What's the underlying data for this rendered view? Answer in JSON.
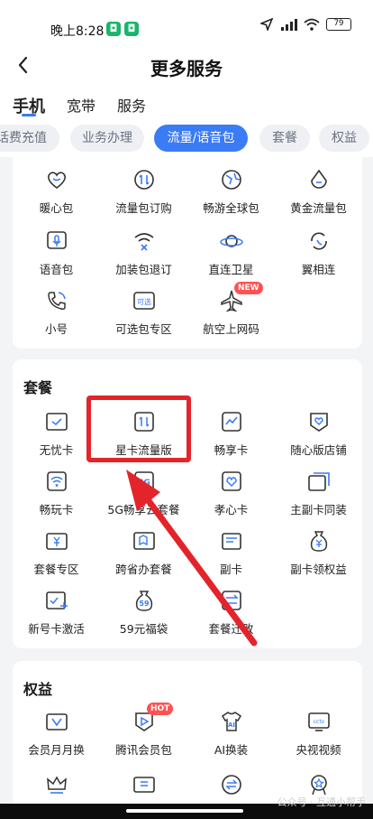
{
  "status_bar": {
    "time": "晚上8:28",
    "app_glyph": "◘",
    "battery": "79"
  },
  "header": {
    "title": "更多服务"
  },
  "top_tabs": [
    {
      "label": "手机"
    },
    {
      "label": "宽带"
    },
    {
      "label": "服务"
    }
  ],
  "pills": [
    {
      "label": "话费充值"
    },
    {
      "label": "业务办理"
    },
    {
      "label": "流量/语音包"
    },
    {
      "label": "套餐"
    },
    {
      "label": "权益"
    }
  ],
  "flow_items": [
    {
      "label": "暖心包",
      "icon": "heart-icon"
    },
    {
      "label": "流量包订购",
      "icon": "data-arrows-icon"
    },
    {
      "label": "畅游全球包",
      "icon": "globe-icon"
    },
    {
      "label": "黄金流量包",
      "icon": "drop-icon"
    },
    {
      "label": "语音包",
      "icon": "mic-icon"
    },
    {
      "label": "加装包退订",
      "icon": "wifi-x-icon"
    },
    {
      "label": "直连卫星",
      "icon": "satellite-icon"
    },
    {
      "label": "翼相连",
      "icon": "phone-rotate-icon"
    },
    {
      "label": "小号",
      "icon": "phone-call-icon"
    },
    {
      "label": "可选包专区",
      "icon": "optional-pack-icon",
      "icon_text": "可选"
    },
    {
      "label": "航空上网码",
      "icon": "airplane-icon",
      "badge": "NEW"
    }
  ],
  "plan_section": {
    "title": "套餐",
    "items": [
      {
        "label": "无忧卡",
        "icon": "card-check-icon"
      },
      {
        "label": "星卡流量版",
        "icon": "data-card-icon"
      },
      {
        "label": "畅享卡",
        "icon": "trend-card-icon"
      },
      {
        "label": "随心版店铺",
        "icon": "heart-shield-icon"
      },
      {
        "label": "畅玩卡",
        "icon": "wifi-card-icon"
      },
      {
        "label": "5G畅享云套餐",
        "icon": "5g-icon",
        "icon_text": "5G"
      },
      {
        "label": "孝心卡",
        "icon": "heart-card-icon"
      },
      {
        "label": "主副卡同装",
        "icon": "dual-card-icon"
      },
      {
        "label": "套餐专区",
        "icon": "yen-folder-icon"
      },
      {
        "label": "跨省办套餐",
        "icon": "map-book-icon"
      },
      {
        "label": "副卡",
        "icon": "sub-card-icon"
      },
      {
        "label": "副卡领权益",
        "icon": "money-bag-icon"
      },
      {
        "label": "新号卡激活",
        "icon": "card-plus-icon"
      },
      {
        "label": "59元福袋",
        "icon": "lucky-bag-icon",
        "icon_text": "59"
      },
      {
        "label": "套餐迁改",
        "icon": "swap-card-icon"
      }
    ]
  },
  "benefit_section": {
    "title": "权益",
    "items": [
      {
        "label": "会员月月换",
        "icon": "vip-folder-icon"
      },
      {
        "label": "腾讯会员包",
        "icon": "play-shield-icon",
        "badge": "HOT"
      },
      {
        "label": "AI换装",
        "icon": "tshirt-icon",
        "icon_text": "AI"
      },
      {
        "label": "央视视频",
        "icon": "tv-icon",
        "icon_text": "cctv"
      }
    ]
  },
  "bottom_peek_icons": [
    "crown-icon",
    "ticket-icon",
    "exchange-icon",
    "medal-icon"
  ],
  "watermark": "公众号 · 互通小帮手",
  "colors": {
    "accent": "#3a7bf6",
    "annotation": "#e3242b"
  }
}
